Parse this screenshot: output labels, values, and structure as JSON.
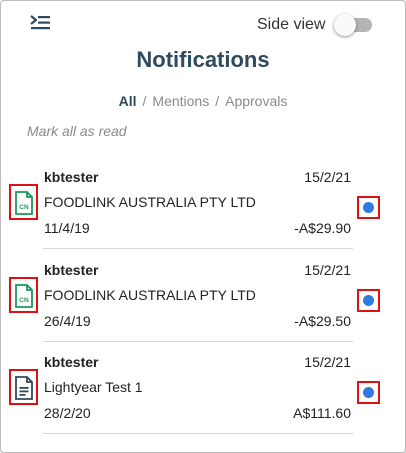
{
  "header": {
    "menu_icon": "collapse-menu-icon",
    "side_view_label": "Side view",
    "side_view_on": false
  },
  "title": "Notifications",
  "filters": [
    {
      "label": "All",
      "active": true
    },
    {
      "label": "Mentions",
      "active": false
    },
    {
      "label": "Approvals",
      "active": false
    }
  ],
  "mark_all_label": "Mark all as read",
  "notifications": [
    {
      "user": "kbtester",
      "date": "15/2/21",
      "title": "FOODLINK AUSTRALIA PTY LTD",
      "doc_date": "11/4/19",
      "amount": "-A$29.90",
      "icon": "credit-note-icon",
      "icon_text": "CN",
      "unread": true
    },
    {
      "user": "kbtester",
      "date": "15/2/21",
      "title": "FOODLINK AUSTRALIA PTY LTD",
      "doc_date": "26/4/19",
      "amount": "-A$29.50",
      "icon": "credit-note-icon",
      "icon_text": "CN",
      "unread": true
    },
    {
      "user": "kbtester",
      "date": "15/2/21",
      "title": "Lightyear Test 1",
      "doc_date": "28/2/20",
      "amount": "A$111.60",
      "icon": "document-icon",
      "unread": true
    }
  ],
  "colors": {
    "accent": "#2f4a5e",
    "unread_dot": "#2f7ae5",
    "credit_note_icon": "#1a9a5a",
    "document_icon": "#2f4a5e"
  }
}
